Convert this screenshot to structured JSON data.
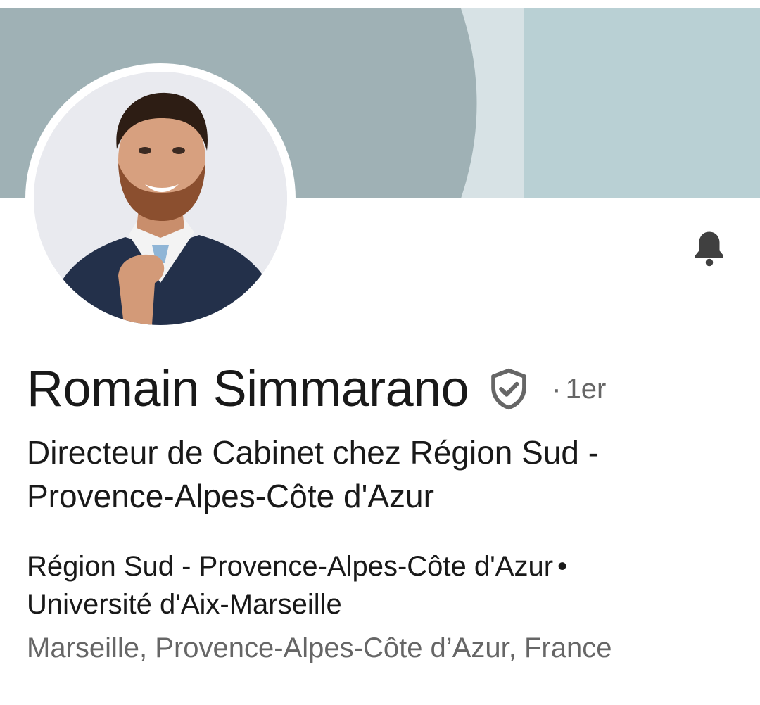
{
  "profile": {
    "name": "Romain Simmarano",
    "degree": "1er",
    "degree_separator": "·",
    "headline": "Directeur de Cabinet chez Région Sud - Provence-Alpes-Côte d'Azur",
    "current_company": "Région Sud - Provence-Alpes-Côte d'Azur",
    "separator": "•",
    "education": "Université d'Aix-Marseille",
    "location": "Marseille, Provence-Alpes-Côte d’Azur, France"
  },
  "icons": {
    "verified": "shield-check-icon",
    "notifications": "bell-icon"
  },
  "colors": {
    "banner_primary": "#9fb1b5",
    "banner_light": "#d7e2e5",
    "banner_right": "#b9d0d4",
    "text_primary": "#191919",
    "text_secondary": "#666666",
    "icon": "#404040"
  }
}
